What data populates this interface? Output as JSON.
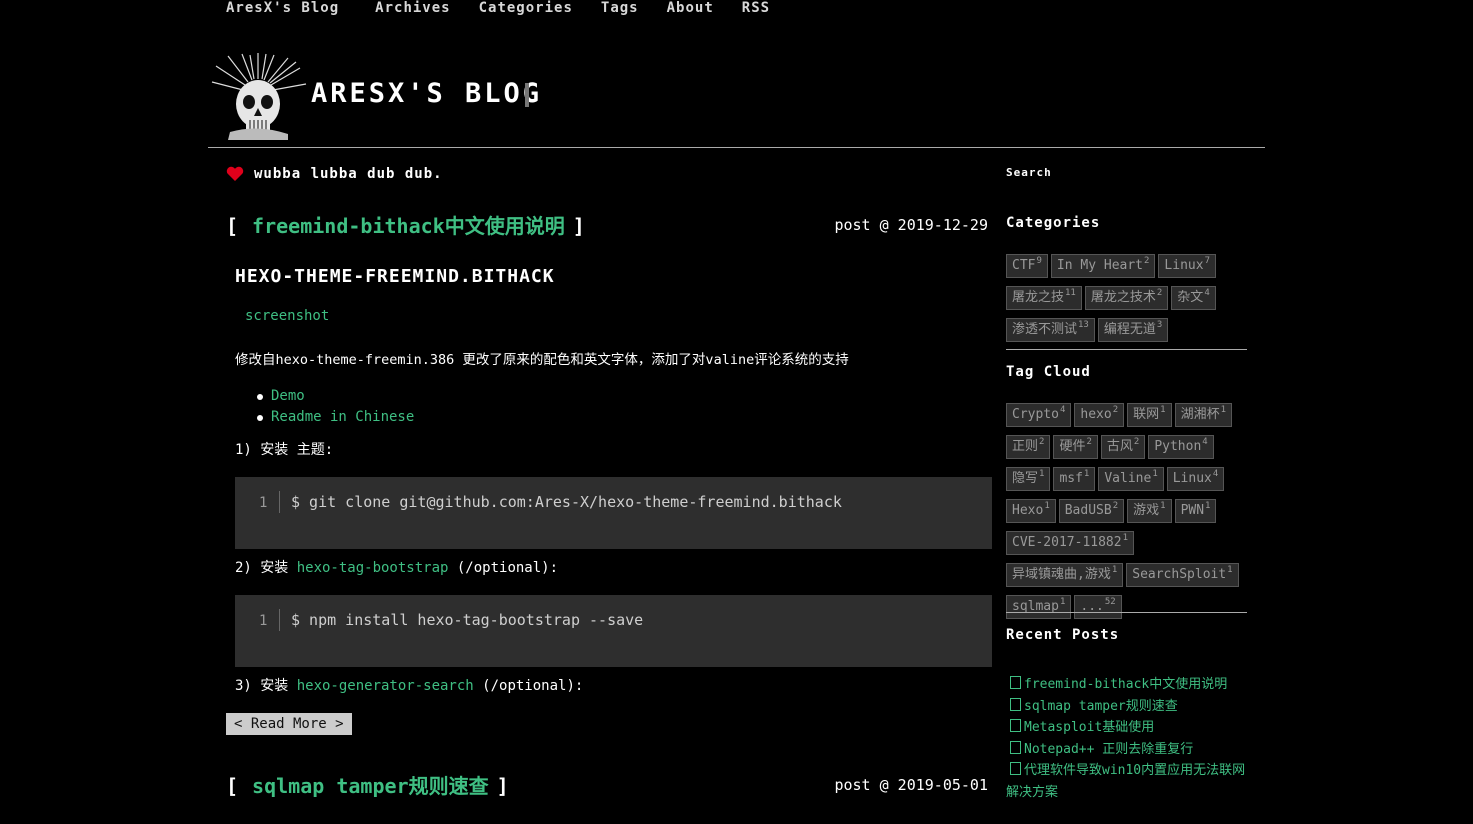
{
  "nav": {
    "items": [
      "AresX's Blog",
      "Archives",
      "Categories",
      "Tags",
      "About",
      "RSS"
    ]
  },
  "header": {
    "title": "ARESX'S BLOG",
    "logo_icon": "skull-mohawk-icon"
  },
  "slogan": {
    "icon": "heart-icon",
    "text": "wubba lubba dub dub."
  },
  "posts": [
    {
      "bracket_open": "[",
      "title": "freemind-bithack中文使用说明",
      "bracket_close": "]",
      "date": "post @ 2019-12-29",
      "heading": "HEXO-THEME-FREEMIND.BITHACK",
      "screenshot_link": "screenshot",
      "desc": "修改自hexo-theme-freemin.386 更改了原来的配色和英文字体，添加了对valine评论系统的支持",
      "links": [
        "Demo",
        "Readme in Chinese"
      ],
      "step1": "1) 安装 主题:",
      "code1_line": "1",
      "code1": "$ git clone git@github.com:Ares-X/hexo-theme-freemind.bithack",
      "step2_pre": "2) 安装 ",
      "step2_link": "hexo-tag-bootstrap",
      "step2_post": " (/optional):",
      "code2_line": "1",
      "code2": "$ npm install hexo-tag-bootstrap --save",
      "step3_pre": "3) 安装 ",
      "step3_link": "hexo-generator-search",
      "step3_post": " (/optional):",
      "read_more": "< Read More >"
    },
    {
      "bracket_open": "[",
      "title": "sqlmap tamper规则速查",
      "bracket_close": "]",
      "date": "post @ 2019-05-01"
    }
  ],
  "sidebar": {
    "search_label": "Search",
    "categories_title": "Categories",
    "categories": [
      {
        "name": "CTF",
        "count": "9"
      },
      {
        "name": "In My Heart",
        "count": "2"
      },
      {
        "name": "Linux",
        "count": "7"
      },
      {
        "name": "屠龙之技",
        "count": "11"
      },
      {
        "name": "屠龙之技术",
        "count": "2"
      },
      {
        "name": "杂文",
        "count": "4"
      },
      {
        "name": "渗透不测试",
        "count": "13"
      },
      {
        "name": "编程无道",
        "count": "3"
      }
    ],
    "tagcloud_title": "Tag Cloud",
    "tags": [
      {
        "name": "Crypto",
        "count": "4"
      },
      {
        "name": "hexo",
        "count": "2"
      },
      {
        "name": "联网",
        "count": "1"
      },
      {
        "name": "湖湘杯",
        "count": "1"
      },
      {
        "name": "正则",
        "count": "2"
      },
      {
        "name": "硬件",
        "count": "2"
      },
      {
        "name": "古风",
        "count": "2"
      },
      {
        "name": "Python",
        "count": "4"
      },
      {
        "name": "隐写",
        "count": "1"
      },
      {
        "name": "msf",
        "count": "1"
      },
      {
        "name": "Valine",
        "count": "1"
      },
      {
        "name": "Linux",
        "count": "4"
      },
      {
        "name": "Hexo",
        "count": "1"
      },
      {
        "name": "BadUSB",
        "count": "2"
      },
      {
        "name": "游戏",
        "count": "1"
      },
      {
        "name": "PWN",
        "count": "1"
      },
      {
        "name": "CVE-2017-11882",
        "count": "1"
      },
      {
        "name": "异域镇魂曲,游戏",
        "count": "1"
      },
      {
        "name": "SearchSploit",
        "count": "1"
      },
      {
        "name": "sqlmap",
        "count": "1"
      },
      {
        "name": "...",
        "count": "52"
      }
    ],
    "recent_title": "Recent Posts",
    "recent_icon": "file-icon",
    "recent_posts": [
      "freemind-bithack中文使用说明",
      "sqlmap tamper规则速查",
      "Metasploit基础使用",
      "Notepad++ 正则去除重复行",
      "代理软件导致win10内置应用无法联网解决方案"
    ]
  },
  "colors": {
    "background": "#000000",
    "accent_green": "#3fbf83",
    "heart_red": "#e0001b",
    "code_bg": "#2e2e2e",
    "tag_bg": "#2c2c2c"
  }
}
